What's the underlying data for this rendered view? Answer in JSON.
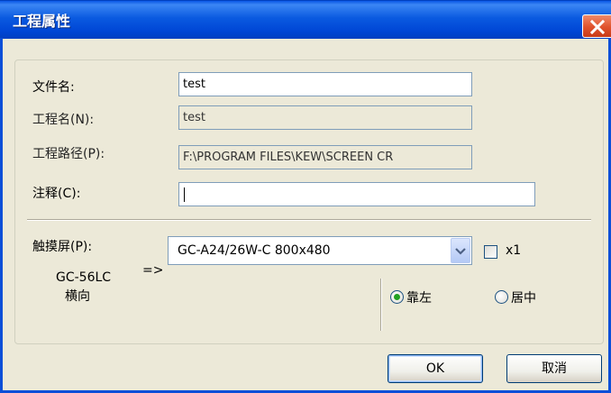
{
  "dialog": {
    "title": "工程属性",
    "colors": {
      "titlebar": "#0a5ae0",
      "close_button": "#e0522c",
      "body": "#ece9d8"
    }
  },
  "fields": {
    "file_name": {
      "label": "文件名:",
      "value": "test"
    },
    "project_name": {
      "label": "工程名(N):",
      "value": "test"
    },
    "project_path": {
      "label": "工程路径(P):",
      "value": "F:\\PROGRAM FILES\\KEW\\SCREEN CR"
    },
    "comment": {
      "label": "注释(C):",
      "value": ""
    }
  },
  "touchscreen": {
    "label": "触摸屏(P):",
    "model_line1": "GC-56LC",
    "model_line2": "横向",
    "arrow": "=>",
    "selected": "GC-A24/26W-C 800x480",
    "x1_label": "x1",
    "x1_checked": false,
    "align_left_label": "靠左",
    "align_center_label": "居中",
    "align_selected": "left"
  },
  "buttons": {
    "ok": "OK",
    "cancel": "取消"
  }
}
